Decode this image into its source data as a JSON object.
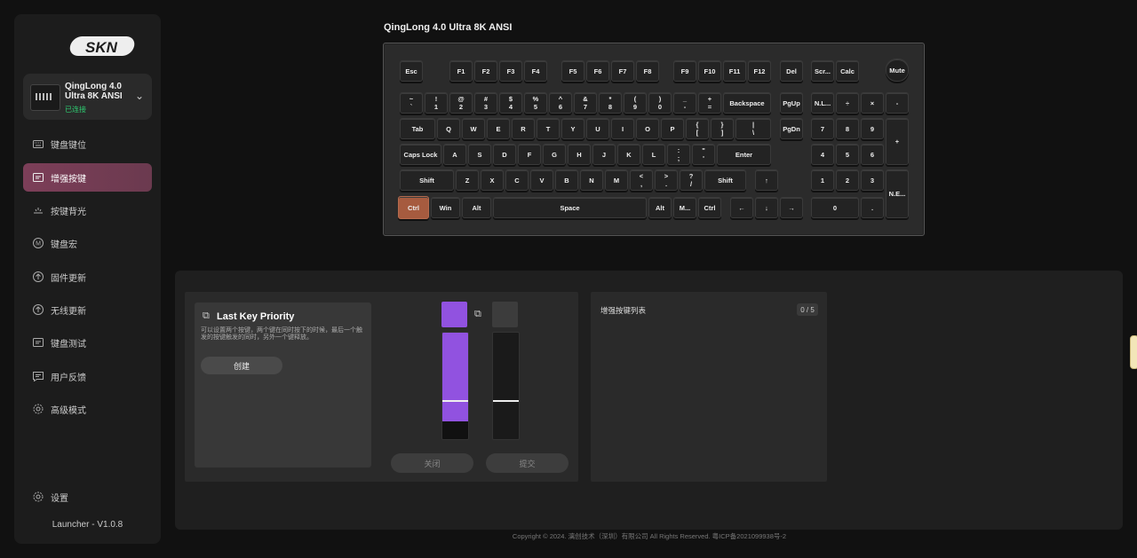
{
  "app": {
    "logo_text": "SKN",
    "version": "Launcher - V1.0.8",
    "footer": "Copyright © 2024. 漓创技术（深圳）有限公司 All Rights Reserved. 粤ICP备2021099938号-2"
  },
  "device": {
    "name": "QingLong 4.0 Ultra 8K ANSI",
    "status": "已连接",
    "status_color": "#2ecc71"
  },
  "sidebar": {
    "items": [
      {
        "label": "键盘键位",
        "icon": "keyboard-icon"
      },
      {
        "label": "增强按键",
        "icon": "enhanced-key-icon",
        "active": true
      },
      {
        "label": "按键背光",
        "icon": "backlight-icon"
      },
      {
        "label": "键盘宏",
        "icon": "macro-icon"
      },
      {
        "label": "固件更新",
        "icon": "firmware-update-icon"
      },
      {
        "label": "无线更新",
        "icon": "wireless-update-icon"
      },
      {
        "label": "键盘测试",
        "icon": "keyboard-test-icon"
      },
      {
        "label": "用户反馈",
        "icon": "feedback-icon"
      },
      {
        "label": "高级模式",
        "icon": "advanced-mode-icon"
      }
    ],
    "settings_label": "设置",
    "active_color": "#7a3e57"
  },
  "keyboard": {
    "title": "QingLong 4.0 Ultra 8K ANSI",
    "active_key_color": "#a65b3f"
  },
  "keys": {
    "esc": "Esc",
    "f1": "F1",
    "f2": "F2",
    "f3": "F3",
    "f4": "F4",
    "f5": "F5",
    "f6": "F6",
    "f7": "F7",
    "f8": "F8",
    "f9": "F9",
    "f10": "F10",
    "f11": "F11",
    "f12": "F12",
    "del": "Del",
    "scr": "Scr...",
    "calc": "Calc",
    "mute": "Mute",
    "tilde": "~\n`",
    "k1": "!\n1",
    "k2": "@\n2",
    "k3": "#\n3",
    "k4": "$\n4",
    "k5": "%\n5",
    "k6": "^\n6",
    "k7": "&\n7",
    "k8": "*\n8",
    "k9": "(\n9",
    "k0": ")\n0",
    "minus": "_\n-",
    "equal": "+\n=",
    "backspace": "Backspace",
    "pgup": "PgUp",
    "numlock": "N.L...",
    "npdiv": "÷",
    "npmul": "×",
    "npminus": "-",
    "tab": "Tab",
    "q": "Q",
    "w": "W",
    "e": "E",
    "r": "R",
    "t": "T",
    "y": "Y",
    "u": "U",
    "i": "I",
    "o": "O",
    "p": "P",
    "lbr": "{\n[",
    "rbr": "}\n]",
    "bslash": "|\n\\",
    "pgdn": "PgDn",
    "np7": "7",
    "np8": "8",
    "np9": "9",
    "npplus": "+",
    "caps": "Caps Lock",
    "a": "A",
    "s": "S",
    "d": "D",
    "f": "F",
    "g": "G",
    "h": "H",
    "j": "J",
    "k": "K",
    "l": "L",
    "semi": ":\n;",
    "quote": "\"\n'",
    "enter": "Enter",
    "np4": "4",
    "np5": "5",
    "np6": "6",
    "lshift": "Shift",
    "z": "Z",
    "x": "X",
    "c": "C",
    "v": "V",
    "b": "B",
    "n": "N",
    "m": "M",
    "comma": "<\n,",
    "period": ">\n.",
    "slash": "?\n/",
    "rshift": "Shift",
    "up": "↑",
    "np1": "1",
    "np2": "2",
    "np3": "3",
    "npenter": "N.E...",
    "lctrl": "Ctrl",
    "win": "Win",
    "lalt": "Alt",
    "space": "Space",
    "ralt": "Alt",
    "menu": "M...",
    "rctrl": "Ctrl",
    "left": "←",
    "down": "↓",
    "right": "→",
    "np0": "0",
    "npdot": "."
  },
  "lkp": {
    "title": "Last Key Priority",
    "description": "可以设置两个按键，两个键在同时按下的时候，最后一个触发的按键触发的同时，另外一个键释放。",
    "create_label": "创建"
  },
  "editor": {
    "key1_color": "#9152e0",
    "key1_fill_fraction": 0.83,
    "key1_marker_fraction": 0.63,
    "key2_marker_fraction": 0.63,
    "close_label": "关闭",
    "submit_label": "提交"
  },
  "list": {
    "title": "增强按键列表",
    "count": "0 / 5"
  }
}
